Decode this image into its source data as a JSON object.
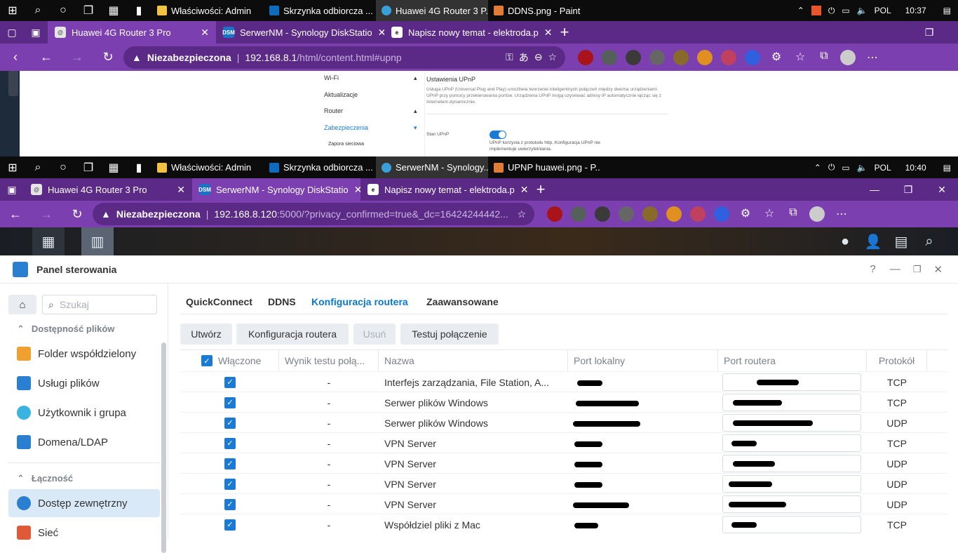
{
  "taskbar_top": {
    "apps": [
      {
        "label": "Właściwości: Admin",
        "color": "#f3c242"
      },
      {
        "label": "Skrzynka odbiorcza ...",
        "color": "#0f6cbd"
      },
      {
        "label": "Huawei 4G Router 3 P...",
        "color": "#3aa0d8"
      },
      {
        "label": "DDNS.png - Paint",
        "color": "#e07b39"
      }
    ],
    "lang": "POL",
    "time": "10:37"
  },
  "browser_top": {
    "tabs": [
      {
        "label": "Huawei 4G Router 3 Pro",
        "fav": "@"
      },
      {
        "label": "SerwerNM - Synology DiskStatio",
        "fav": "DSM"
      },
      {
        "label": "Napisz nowy temat - elektroda.p",
        "fav": "e"
      }
    ],
    "not_secure": "Niezabezpieczona",
    "url_host": "192.168.8.1",
    "url_path": "/html/content.html#upnp"
  },
  "router_page": {
    "sidebar": [
      "Wi-Fi",
      "Aktualizacje",
      "Router",
      "Zabezpieczenia",
      "Zapora sieciowa"
    ],
    "heading": "Ustawienia UPnP",
    "description": "Usługa UPnP (Universal Plug and Play) umożliwia tworzenie inteligentnych połączeń między dwoma urządzeniami UPnP przy pomocy przekierowania portów. Urządzenia UPnP mogą uzyskiwać adresy IP automatycznie łącząc się z Internetem dynamicznie.",
    "status_label": "Stan UPnP",
    "status_note": "UPnP korzysta z protokołu http. Konfiguracja UPnP nie implementuje uwierzytelniania."
  },
  "taskbar_bottom": {
    "apps": [
      {
        "label": "Właściwości: Admin",
        "color": "#f3c242"
      },
      {
        "label": "Skrzynka odbiorcza ...",
        "color": "#0f6cbd"
      },
      {
        "label": "SerwerNM - Synology...",
        "color": "#3aa0d8"
      },
      {
        "label": "UPNP huawei.png - P...",
        "color": "#e07b39"
      }
    ],
    "lang": "POL",
    "time": "10:40"
  },
  "browser_bottom": {
    "tabs": [
      {
        "label": "Huawei 4G Router 3 Pro",
        "fav": "@"
      },
      {
        "label": "SerwerNM - Synology DiskStatio",
        "fav": "DSM"
      },
      {
        "label": "Napisz nowy temat - elektroda.p",
        "fav": "e"
      }
    ],
    "not_secure": "Niezabezpieczona",
    "url_host": "192.168.8.120",
    "url_path": ":5000/?privacy_confirmed=true&_dc=16424244442..."
  },
  "control_panel": {
    "title": "Panel sterowania",
    "search_placeholder": "Szukaj",
    "groups": [
      {
        "label": "Dostępność plików"
      },
      {
        "label": "Łączność"
      }
    ],
    "items": [
      {
        "label": "Folder współdzielony",
        "color": "#f0a030"
      },
      {
        "label": "Usługi plików",
        "color": "#2a7fd0"
      },
      {
        "label": "Użytkownik i grupa",
        "color": "#3bb3e0"
      },
      {
        "label": "Domena/LDAP",
        "color": "#2a7fd0"
      },
      {
        "label": "Dostęp zewnętrzny",
        "color": "#2a7fd0"
      },
      {
        "label": "Sieć",
        "color": "#e05a3a"
      }
    ],
    "tabs": [
      "QuickConnect",
      "DDNS",
      "Konfiguracja routera",
      "Zaawansowane"
    ],
    "buttons": [
      "Utwórz",
      "Konfiguracja routera",
      "Usuń",
      "Testuj połączenie"
    ],
    "columns": [
      "Włączone",
      "Wynik testu połą...",
      "Nazwa",
      "Port lokalny",
      "Port routera",
      "Protokół"
    ],
    "rows": [
      {
        "result": "-",
        "name": "Interfejs zarządzania, File Station, A...",
        "proto": "TCP"
      },
      {
        "result": "-",
        "name": "Serwer plików Windows",
        "proto": "TCP"
      },
      {
        "result": "-",
        "name": "Serwer plików Windows",
        "proto": "UDP"
      },
      {
        "result": "-",
        "name": "VPN Server",
        "proto": "TCP"
      },
      {
        "result": "-",
        "name": "VPN Server",
        "proto": "UDP"
      },
      {
        "result": "-",
        "name": "VPN Server",
        "proto": "UDP"
      },
      {
        "result": "-",
        "name": "VPN Server",
        "proto": "UDP"
      },
      {
        "result": "-",
        "name": "Współdziel pliki z Mac",
        "proto": "TCP"
      }
    ]
  }
}
